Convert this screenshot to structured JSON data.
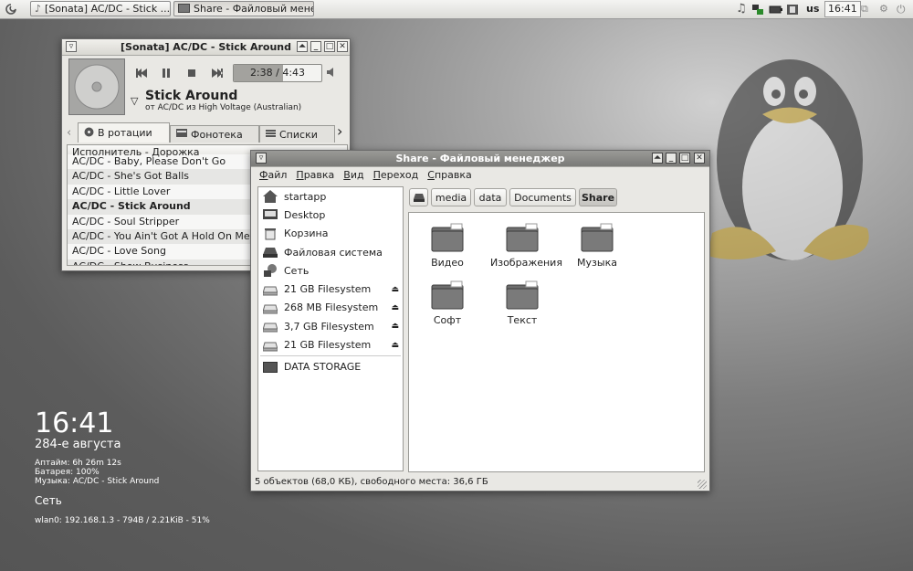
{
  "taskbar": {
    "tasks": [
      {
        "label": "[Sonata] AC/DC - Stick ..."
      },
      {
        "label": "Share - Файловый мене..."
      }
    ],
    "keyboard_layout": "us",
    "clock": "16:41"
  },
  "sonata": {
    "title": "[Sonata] AC/DC - Stick Around",
    "time": "2:38 / 4:43",
    "progress": 0.56,
    "song_title": "Stick Around",
    "song_subtitle": "от AC/DC из High Voltage (Australian)",
    "tabs": [
      "В ротации",
      "Фонотека",
      "Списки"
    ],
    "column_header": "Исполнитель - Дорожка",
    "playlist": [
      "AC/DC - Baby, Please Don't Go",
      "AC/DC - She's Got Balls",
      "AC/DC - Little Lover",
      "AC/DC - Stick Around",
      "AC/DC - Soul Stripper",
      "AC/DC - You Ain't Got A Hold On Me",
      "AC/DC - Love Song",
      "AC/DC - Show Business"
    ],
    "current_index": 3
  },
  "filemanager": {
    "title": "Share - Файловый менеджер",
    "menu": [
      "Файл",
      "Правка",
      "Вид",
      "Переход",
      "Справка"
    ],
    "sidebar": [
      {
        "label": "startapp",
        "icon": "home-icon",
        "eject": false
      },
      {
        "label": "Desktop",
        "icon": "desktop-icon",
        "eject": false
      },
      {
        "label": "Корзина",
        "icon": "trash-icon",
        "eject": false
      },
      {
        "label": "Файловая система",
        "icon": "harddisk-icon",
        "eject": false
      },
      {
        "label": "Сеть",
        "icon": "network-icon",
        "eject": false
      },
      {
        "label": "21 GB Filesystem",
        "icon": "drive-icon",
        "eject": true
      },
      {
        "label": "268 MB Filesystem",
        "icon": "drive-icon",
        "eject": true
      },
      {
        "label": "3,7 GB Filesystem",
        "icon": "drive-icon",
        "eject": true
      },
      {
        "label": "21 GB Filesystem",
        "icon": "drive-icon",
        "eject": true
      }
    ],
    "bookmarks": [
      {
        "label": "DATA STORAGE",
        "icon": "folder-icon"
      }
    ],
    "breadcrumbs": [
      "media",
      "data",
      "Documents",
      "Share"
    ],
    "folders": [
      "Видео",
      "Изображения",
      "Музыка",
      "Софт",
      "Текст"
    ],
    "status": "5 объектов (68,0 КБ), свободного места: 36,6 ГБ"
  },
  "conky": {
    "time": "16:41",
    "date": "284-е августа",
    "uptime": "Аптайм: 6h 26m 12s",
    "battery": "Батарея: 100%",
    "music": "Музыка: AC/DC - Stick Around",
    "network_title": "Сеть",
    "network_info": "wlan0: 192.168.1.3 - 794B / 2.21KiB - 51%"
  }
}
